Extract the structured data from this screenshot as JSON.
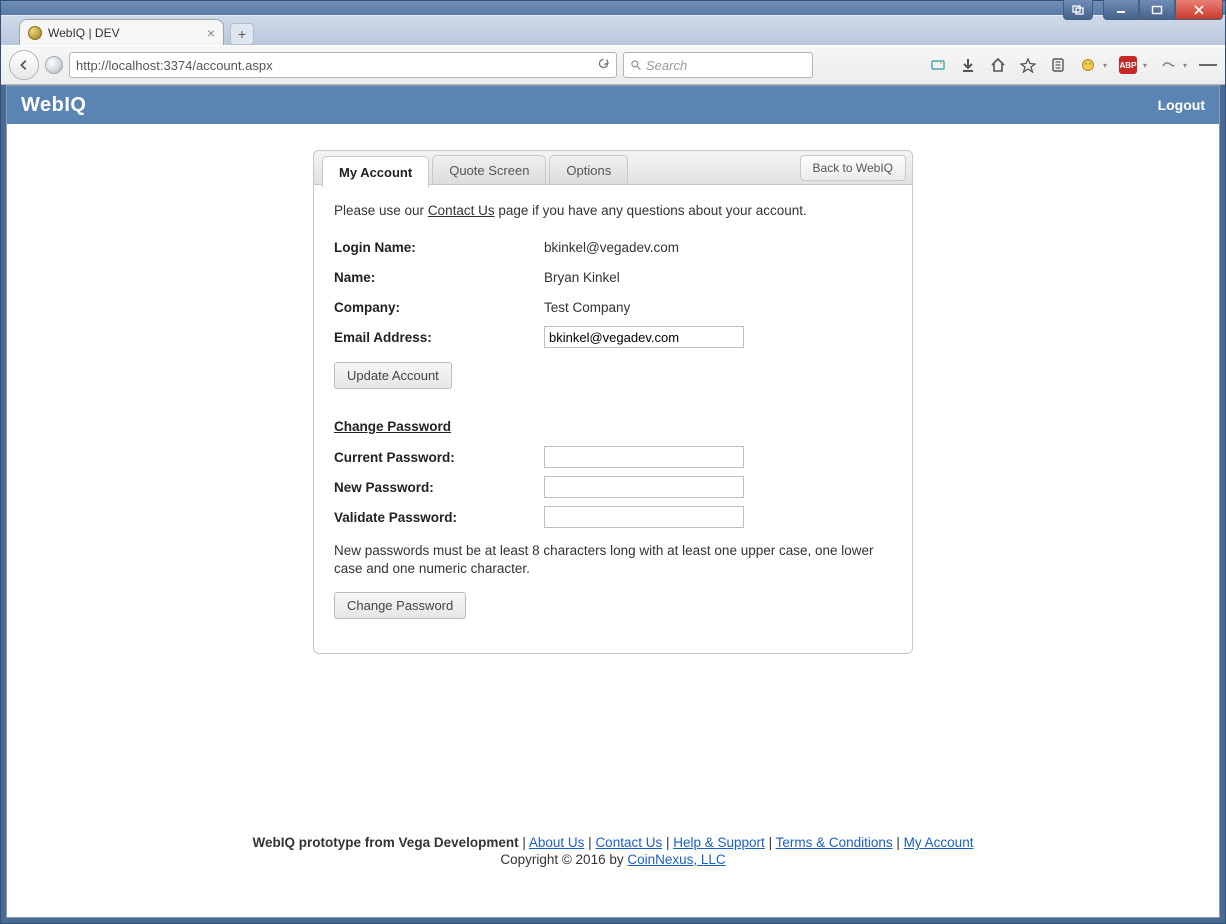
{
  "browser": {
    "tab_title": "WebIQ | DEV",
    "url": "http://localhost:3374/account.aspx",
    "search_placeholder": "Search"
  },
  "app": {
    "brand": "WebIQ",
    "logout": "Logout"
  },
  "tabs": {
    "my_account": "My Account",
    "quote_screen": "Quote Screen",
    "options": "Options",
    "back": "Back to WebIQ"
  },
  "intro": {
    "pre": "Please use our ",
    "link": "Contact Us",
    "post": " page if you have any questions about your account."
  },
  "account": {
    "login_label": "Login Name:",
    "login_value": "bkinkel@vegadev.com",
    "name_label": "Name:",
    "name_value": "Bryan Kinkel",
    "company_label": "Company:",
    "company_value": "Test Company",
    "email_label": "Email Address:",
    "email_value": "bkinkel@vegadev.com",
    "update_btn": "Update Account"
  },
  "password": {
    "section": "Change Password",
    "current_label": "Current Password:",
    "new_label": "New Password:",
    "validate_label": "Validate Password:",
    "hint": "New passwords must be at least 8 characters long with at least one upper case, one lower case and one numeric character.",
    "change_btn": "Change Password"
  },
  "footer": {
    "lead": "WebIQ prototype from Vega Development",
    "about": "About Us",
    "contact": "Contact Us",
    "help": "Help & Support",
    "terms": "Terms & Conditions",
    "myacct": "My Account",
    "copyright_pre": "Copyright © 2016 by ",
    "copyright_link": "CoinNexus, LLC"
  }
}
